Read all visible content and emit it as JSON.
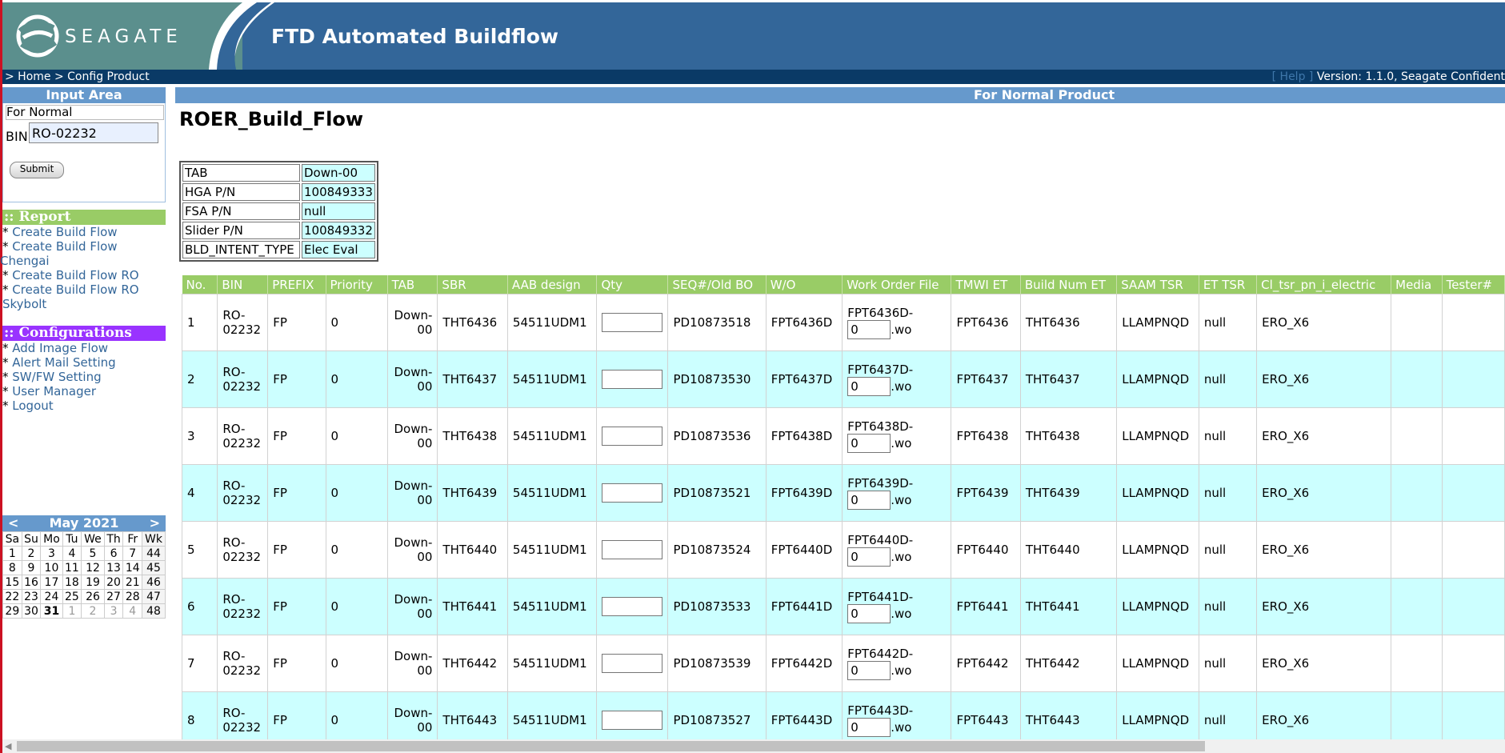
{
  "header": {
    "logo_text": "SEAGATE",
    "app_title": "FTD Automated Buildflow",
    "brand_color": "#336699"
  },
  "navbar": {
    "breadcrumb": "> Home > Config Product",
    "help": "[ Help ]",
    "version": "Version: 1.1.0, Seagate Confident"
  },
  "sidebar": {
    "input_area": {
      "title": "Input Area",
      "mode_label": "For Normal",
      "bin_label": "BIN",
      "bin_value": "RO-02232",
      "submit_label": "Submit"
    },
    "report": {
      "title": ":: Report",
      "color": "#99cc66",
      "items": [
        {
          "prefix": "* ",
          "label": "Create Build Flow",
          "rest": ""
        },
        {
          "prefix": "* ",
          "label": "Create Build Flow",
          "rest": "Chengai"
        },
        {
          "prefix": "* ",
          "label": "Create Build Flow RO",
          "rest": ""
        },
        {
          "prefix": "* ",
          "label": "Create Build Flow RO",
          "rest": "Skybolt"
        }
      ]
    },
    "configurations": {
      "title": ":: Configurations",
      "color": "#9933ff",
      "items": [
        {
          "prefix": "* ",
          "label": "Add Image Flow"
        },
        {
          "prefix": "* ",
          "label": "Alert Mail Setting"
        },
        {
          "prefix": "* ",
          "label": "SW/FW Setting"
        },
        {
          "prefix": "* ",
          "label": "User Manager"
        },
        {
          "prefix": "* ",
          "label": "Logout"
        }
      ]
    },
    "calendar": {
      "month": "May 2021",
      "prev": "<",
      "next": ">",
      "weekdays": [
        "Sa",
        "Su",
        "Mo",
        "Tu",
        "We",
        "Th",
        "Fr",
        "Wk"
      ],
      "weeks": [
        [
          "1",
          "2",
          "3",
          "4",
          "5",
          "6",
          "7",
          "44"
        ],
        [
          "8",
          "9",
          "10",
          "11",
          "12",
          "13",
          "14",
          "45"
        ],
        [
          "15",
          "16",
          "17",
          "18",
          "19",
          "20",
          "21",
          "46"
        ],
        [
          "22",
          "23",
          "24",
          "25",
          "26",
          "27",
          "28",
          "47"
        ],
        [
          "29",
          "30",
          "31",
          "1",
          "2",
          "3",
          "4",
          "48"
        ]
      ],
      "today": "31"
    }
  },
  "main": {
    "panel_title": "For Normal Product",
    "page_title": "ROER_Build_Flow",
    "info": [
      {
        "key": "TAB",
        "value": "Down-00"
      },
      {
        "key": "HGA P/N",
        "value": "100849333"
      },
      {
        "key": "FSA P/N",
        "value": "null"
      },
      {
        "key": "Slider P/N",
        "value": "100849332"
      },
      {
        "key": "BLD_INTENT_TYPE",
        "value": "Elec Eval"
      }
    ],
    "columns": [
      "No.",
      "BIN",
      "PREFIX",
      "Priority",
      "TAB",
      "SBR",
      "AAB design",
      "Qty",
      "SEQ#/Old BO",
      "W/O",
      "Work Order File",
      "TMWI ET",
      "Build Num ET",
      "SAAM TSR",
      "ET TSR",
      "Cl_tsr_pn_i_electric",
      "Media",
      "Tester#"
    ],
    "wo_ext": ".wo",
    "rows": [
      {
        "no": "1",
        "bin": "RO-02232",
        "prefix": "FP",
        "priority": "0",
        "tab": "Down-00",
        "sbr": "THT6436",
        "aab": "54511UDM1",
        "qty": "",
        "seq": "PD10873518",
        "wo": "FPT6436D",
        "wo_file": "FPT6436D-",
        "wo_num": "0",
        "tmwi": "FPT6436",
        "build_num": "THT6436",
        "saam": "LLAMPNQD",
        "et_tsr": "null",
        "cl_tsr": "ERO_X6",
        "media": "",
        "tester": ""
      },
      {
        "no": "2",
        "bin": "RO-02232",
        "prefix": "FP",
        "priority": "0",
        "tab": "Down-00",
        "sbr": "THT6437",
        "aab": "54511UDM1",
        "qty": "",
        "seq": "PD10873530",
        "wo": "FPT6437D",
        "wo_file": "FPT6437D-",
        "wo_num": "0",
        "tmwi": "FPT6437",
        "build_num": "THT6437",
        "saam": "LLAMPNQD",
        "et_tsr": "null",
        "cl_tsr": "ERO_X6",
        "media": "",
        "tester": ""
      },
      {
        "no": "3",
        "bin": "RO-02232",
        "prefix": "FP",
        "priority": "0",
        "tab": "Down-00",
        "sbr": "THT6438",
        "aab": "54511UDM1",
        "qty": "",
        "seq": "PD10873536",
        "wo": "FPT6438D",
        "wo_file": "FPT6438D-",
        "wo_num": "0",
        "tmwi": "FPT6438",
        "build_num": "THT6438",
        "saam": "LLAMPNQD",
        "et_tsr": "null",
        "cl_tsr": "ERO_X6",
        "media": "",
        "tester": ""
      },
      {
        "no": "4",
        "bin": "RO-02232",
        "prefix": "FP",
        "priority": "0",
        "tab": "Down-00",
        "sbr": "THT6439",
        "aab": "54511UDM1",
        "qty": "",
        "seq": "PD10873521",
        "wo": "FPT6439D",
        "wo_file": "FPT6439D-",
        "wo_num": "0",
        "tmwi": "FPT6439",
        "build_num": "THT6439",
        "saam": "LLAMPNQD",
        "et_tsr": "null",
        "cl_tsr": "ERO_X6",
        "media": "",
        "tester": ""
      },
      {
        "no": "5",
        "bin": "RO-02232",
        "prefix": "FP",
        "priority": "0",
        "tab": "Down-00",
        "sbr": "THT6440",
        "aab": "54511UDM1",
        "qty": "",
        "seq": "PD10873524",
        "wo": "FPT6440D",
        "wo_file": "FPT6440D-",
        "wo_num": "0",
        "tmwi": "FPT6440",
        "build_num": "THT6440",
        "saam": "LLAMPNQD",
        "et_tsr": "null",
        "cl_tsr": "ERO_X6",
        "media": "",
        "tester": ""
      },
      {
        "no": "6",
        "bin": "RO-02232",
        "prefix": "FP",
        "priority": "0",
        "tab": "Down-00",
        "sbr": "THT6441",
        "aab": "54511UDM1",
        "qty": "",
        "seq": "PD10873533",
        "wo": "FPT6441D",
        "wo_file": "FPT6441D-",
        "wo_num": "0",
        "tmwi": "FPT6441",
        "build_num": "THT6441",
        "saam": "LLAMPNQD",
        "et_tsr": "null",
        "cl_tsr": "ERO_X6",
        "media": "",
        "tester": ""
      },
      {
        "no": "7",
        "bin": "RO-02232",
        "prefix": "FP",
        "priority": "0",
        "tab": "Down-00",
        "sbr": "THT6442",
        "aab": "54511UDM1",
        "qty": "",
        "seq": "PD10873539",
        "wo": "FPT6442D",
        "wo_file": "FPT6442D-",
        "wo_num": "0",
        "tmwi": "FPT6442",
        "build_num": "THT6442",
        "saam": "LLAMPNQD",
        "et_tsr": "null",
        "cl_tsr": "ERO_X6",
        "media": "",
        "tester": ""
      },
      {
        "no": "8",
        "bin": "RO-02232",
        "prefix": "FP",
        "priority": "0",
        "tab": "Down-00",
        "sbr": "THT6443",
        "aab": "54511UDM1",
        "qty": "",
        "seq": "PD10873527",
        "wo": "FPT6443D",
        "wo_file": "FPT6443D-",
        "wo_num": "0",
        "tmwi": "FPT6443",
        "build_num": "THT6443",
        "saam": "LLAMPNQD",
        "et_tsr": "null",
        "cl_tsr": "ERO_X6",
        "media": "",
        "tester": ""
      }
    ]
  }
}
